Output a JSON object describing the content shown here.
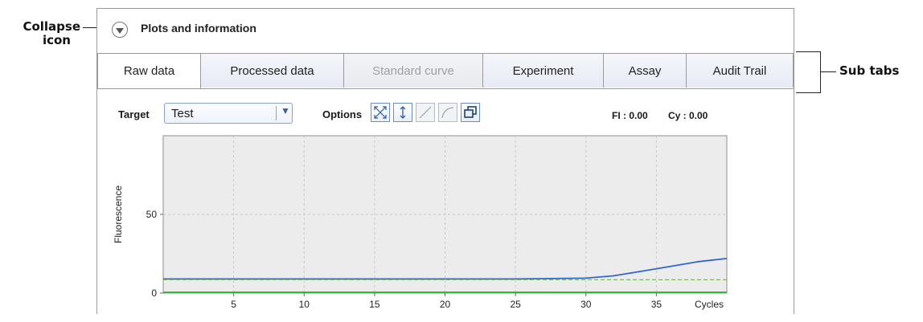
{
  "annotations": {
    "collapse_line1": "Collapse",
    "collapse_line2": "icon",
    "subtabs": "Sub tabs"
  },
  "panel": {
    "title": "Plots and information",
    "collapse_icon": "chevron-down-circle-icon"
  },
  "tabs": [
    {
      "label": "Raw data",
      "active": true,
      "disabled": false
    },
    {
      "label": "Processed data",
      "active": false,
      "disabled": false
    },
    {
      "label": "Standard curve",
      "active": false,
      "disabled": true
    },
    {
      "label": "Experiment",
      "active": false,
      "disabled": false
    },
    {
      "label": "Assay",
      "active": false,
      "disabled": false
    },
    {
      "label": "Audit Trail",
      "active": false,
      "disabled": false
    }
  ],
  "toolbar": {
    "target_label": "Target",
    "target_value": "Test",
    "options_label": "Options",
    "option_icons": [
      "fit-all-icon",
      "fit-vertical-icon",
      "line-icon",
      "curve-icon",
      "overlay-windows-icon"
    ],
    "fi_readout": "FI : 0.00",
    "cy_readout": "Cy : 0.00"
  },
  "chart_data": {
    "type": "line",
    "xlabel": "Cycles",
    "ylabel": "Fluorescence",
    "xlim": [
      0,
      40
    ],
    "ylim": [
      0,
      100
    ],
    "xticks": [
      5,
      10,
      15,
      20,
      25,
      30,
      35
    ],
    "yticks": [
      0,
      50
    ],
    "grid": true,
    "series": [
      {
        "color": "#3366cc",
        "style": "solid",
        "x": [
          0,
          5,
          10,
          15,
          20,
          25,
          30,
          32,
          34,
          36,
          38,
          40
        ],
        "y": [
          9,
          9,
          9,
          9,
          9,
          9,
          9.5,
          11,
          14,
          17,
          20,
          22
        ]
      },
      {
        "color": "#66bb33",
        "style": "dashed",
        "x": [
          0,
          10,
          20,
          30,
          40
        ],
        "y": [
          8.5,
          8.5,
          8.5,
          8.5,
          8.5
        ]
      },
      {
        "color": "#22bb22",
        "style": "solid",
        "x": [
          0,
          10,
          20,
          30,
          40
        ],
        "y": [
          0.5,
          0.5,
          0.5,
          0.5,
          0.5
        ]
      }
    ],
    "colors": {
      "background": "#ececec",
      "grid": "#c8c8c8"
    }
  }
}
